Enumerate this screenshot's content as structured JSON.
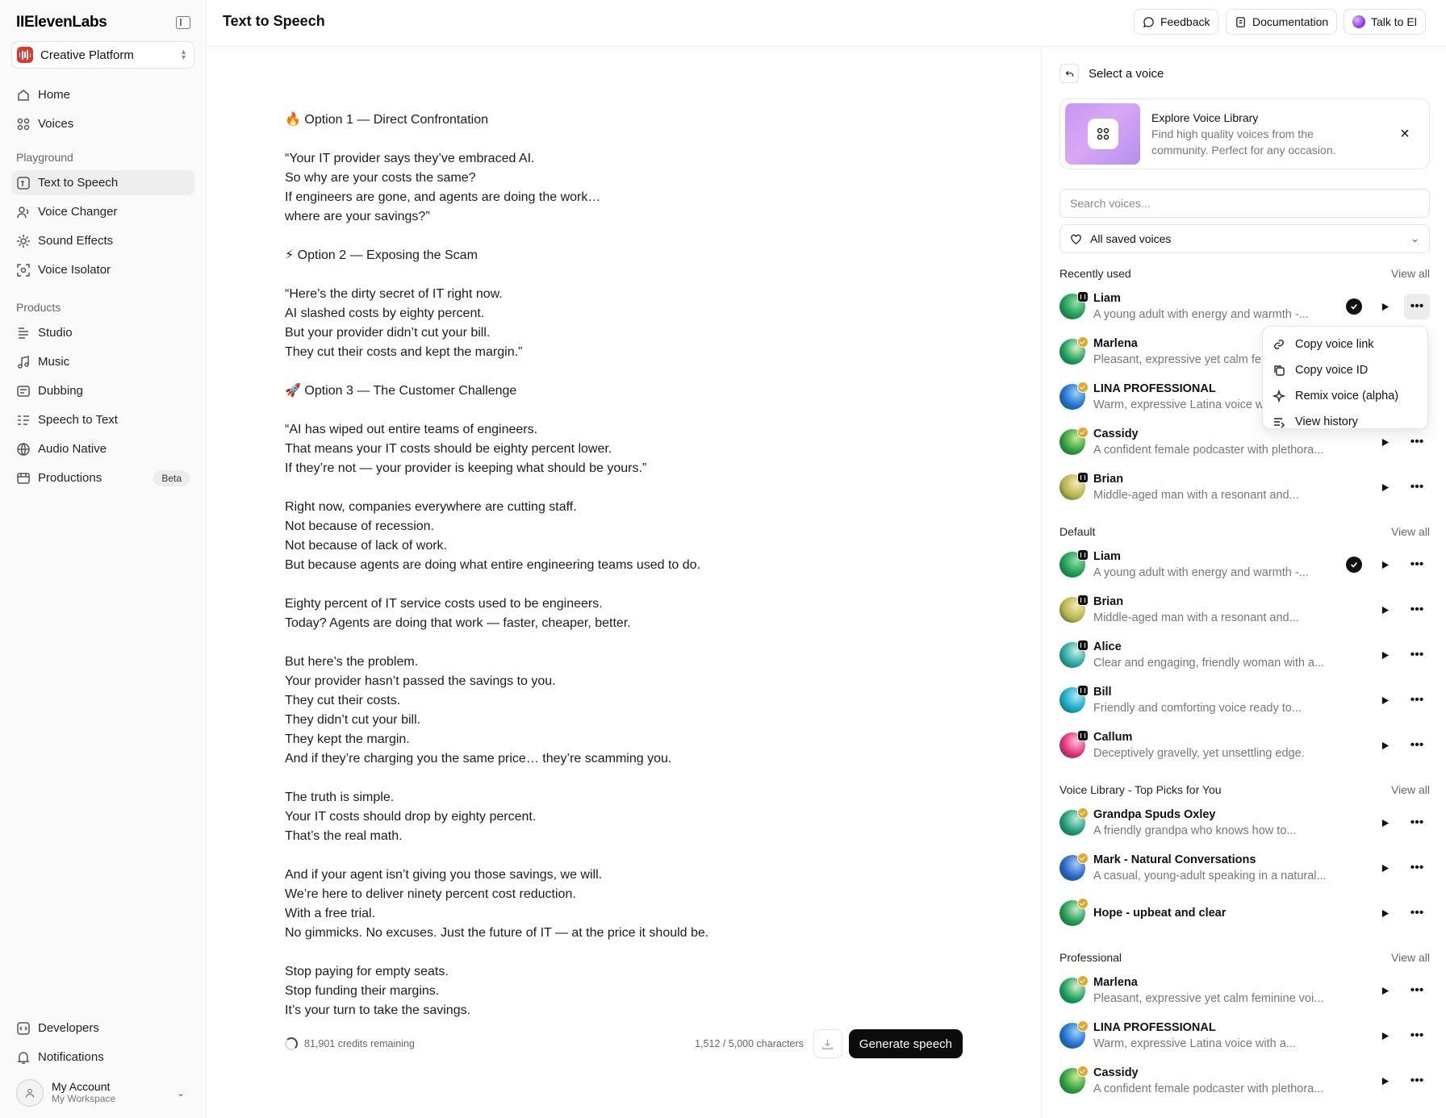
{
  "sidebar": {
    "logo": "IIElevenLabs",
    "workspace": "Creative Platform",
    "top_items": [
      {
        "label": "Home",
        "icon": "home-icon"
      },
      {
        "label": "Voices",
        "icon": "voices-icon"
      }
    ],
    "playground_label": "Playground",
    "playground_items": [
      {
        "label": "Text to Speech",
        "icon": "text-to-speech-icon",
        "active": true
      },
      {
        "label": "Voice Changer",
        "icon": "voice-changer-icon"
      },
      {
        "label": "Sound Effects",
        "icon": "sound-effects-icon"
      },
      {
        "label": "Voice Isolator",
        "icon": "voice-isolator-icon"
      }
    ],
    "products_label": "Products",
    "product_items": [
      {
        "label": "Studio",
        "icon": "studio-icon"
      },
      {
        "label": "Music",
        "icon": "music-icon"
      },
      {
        "label": "Dubbing",
        "icon": "dubbing-icon"
      },
      {
        "label": "Speech to Text",
        "icon": "speech-to-text-icon"
      },
      {
        "label": "Audio Native",
        "icon": "audio-native-icon"
      },
      {
        "label": "Productions",
        "icon": "productions-icon",
        "badge": "Beta"
      }
    ],
    "bottom_items": [
      {
        "label": "Developers",
        "icon": "developers-icon"
      },
      {
        "label": "Notifications",
        "icon": "bell-icon"
      }
    ],
    "account": {
      "name": "My Account",
      "workspace": "My Workspace"
    }
  },
  "header": {
    "title": "Text to Speech",
    "feedback": "Feedback",
    "documentation": "Documentation",
    "talk": "Talk to El"
  },
  "editor": {
    "text": "🔥 Option 1 — Direct Confrontation\n\n“Your IT provider says they’ve embraced AI.\nSo why are your costs the same?\nIf engineers are gone, and agents are doing the work…\nwhere are your savings?”\n\n⚡ Option 2 — Exposing the Scam\n\n“Here’s the dirty secret of IT right now.\nAI slashed costs by eighty percent.\nBut your provider didn’t cut your bill.\nThey cut their costs and kept the margin.”\n\n🚀 Option 3 — The Customer Challenge\n\n“AI has wiped out entire teams of engineers.\nThat means your IT costs should be eighty percent lower.\nIf they’re not — your provider is keeping what should be yours.”\n\nRight now, companies everywhere are cutting staff.\nNot because of recession.\nNot because of lack of work.\nBut because agents are doing what entire engineering teams used to do.\n\nEighty percent of IT service costs used to be engineers.\nToday? Agents are doing that work — faster, cheaper, better.\n\nBut here’s the problem.\nYour provider hasn’t passed the savings to you.\nThey cut their costs.\nThey didn’t cut your bill.\nThey kept the margin.\nAnd if they’re charging you the same price… they’re scamming you.\n\nThe truth is simple.\nYour IT costs should drop by eighty percent.\nThat’s the real math.\n\nAnd if your agent isn’t giving you those savings, we will.\nWe’re here to deliver ninety percent cost reduction.\nWith a free trial.\nNo gimmicks. No excuses. Just the future of IT — at the price it should be.\n\nStop paying for empty seats.\nStop funding their margins.\nIt’s your turn to take the savings.",
    "credits": "81,901 credits remaining",
    "char_count": "1,512 / 5,000 characters",
    "generate": "Generate speech"
  },
  "panel": {
    "title": "Select a voice",
    "promo_title": "Explore Voice Library",
    "promo_desc": "Find high quality voices from the community. Perfect for any occasion.",
    "search_placeholder": "Search voices...",
    "filter": "All saved voices",
    "view_all": "View all",
    "groups": [
      {
        "title": "Recently used",
        "voices": [
          {
            "name": "Liam",
            "desc": "A young adult with energy and warmth -...",
            "badge": "dark",
            "selected": true,
            "menu_open": true,
            "colors": [
              "#1e9b54",
              "#8fe0a5"
            ]
          },
          {
            "name": "Marlena",
            "desc": "Pleasant, expressive yet calm fe",
            "badge": "gold",
            "colors": [
              "#1b9f5e",
              "#d9f0c5"
            ]
          },
          {
            "name": "LINA PROFESSIONAL",
            "desc": "Warm, expressive Latina voice w",
            "badge": "gold",
            "colors": [
              "#1f6fd1",
              "#9dd1f7"
            ]
          },
          {
            "name": "Cassidy",
            "desc": "A confident female podcaster with plethora...",
            "badge": "gold",
            "colors": [
              "#2e9e3f",
              "#c6ea8f"
            ]
          },
          {
            "name": "Brian",
            "desc": "Middle-aged man with a resonant and...",
            "badge": "dark",
            "colors": [
              "#b9b24a",
              "#f1ecb4"
            ]
          }
        ]
      },
      {
        "title": "Default",
        "voices": [
          {
            "name": "Liam",
            "desc": "A young adult with energy and warmth -...",
            "badge": "dark",
            "selected": true,
            "colors": [
              "#1e9b54",
              "#8fe0a5"
            ]
          },
          {
            "name": "Brian",
            "desc": "Middle-aged man with a resonant and...",
            "badge": "dark",
            "colors": [
              "#b9b24a",
              "#f1ecb4"
            ]
          },
          {
            "name": "Alice",
            "desc": "Clear and engaging, friendly woman with a...",
            "badge": "dark",
            "colors": [
              "#2aa7a0",
              "#c6f0ea"
            ]
          },
          {
            "name": "Bill",
            "desc": "Friendly and comforting voice ready to...",
            "badge": "dark",
            "colors": [
              "#18a6c7",
              "#a7ecf3"
            ]
          },
          {
            "name": "Callum",
            "desc": "Deceptively gravelly, yet unsettling edge.",
            "badge": "dark",
            "colors": [
              "#e3307a",
              "#ffc0d8"
            ]
          }
        ]
      },
      {
        "title": "Voice Library - Top Picks for You",
        "voices": [
          {
            "name": "Grandpa Spuds Oxley",
            "desc": "A friendly grandpa who knows how to...",
            "badge": "gold",
            "colors": [
              "#1d9a78",
              "#bfeadd"
            ]
          },
          {
            "name": "Mark - Natural Conversations",
            "desc": "A casual, young-adult speaking in a natural...",
            "badge": "gold",
            "colors": [
              "#2563c9",
              "#a9c9f4"
            ]
          },
          {
            "name": "Hope - upbeat and clear",
            "desc": "",
            "badge": "gold",
            "colors": [
              "#249a52",
              "#c3ecc9"
            ]
          }
        ]
      },
      {
        "title": "Professional",
        "voices": [
          {
            "name": "Marlena",
            "desc": "Pleasant, expressive yet calm feminine voi...",
            "badge": "gold",
            "colors": [
              "#1b9f5e",
              "#d9f0c5"
            ]
          },
          {
            "name": "LINA PROFESSIONAL",
            "desc": "Warm, expressive Latina voice with a...",
            "badge": "gold",
            "colors": [
              "#1f6fd1",
              "#9dd1f7"
            ]
          },
          {
            "name": "Cassidy",
            "desc": "A confident female podcaster with plethora...",
            "badge": "gold",
            "colors": [
              "#2e9e3f",
              "#c6ea8f"
            ]
          }
        ]
      }
    ]
  },
  "context_menu": [
    {
      "label": "Copy voice link",
      "icon": "link-icon"
    },
    {
      "label": "Copy voice ID",
      "icon": "copy-icon"
    },
    {
      "label": "Remix voice (alpha)",
      "icon": "sparkle-icon"
    },
    {
      "label": "View history",
      "icon": "history-icon"
    }
  ]
}
